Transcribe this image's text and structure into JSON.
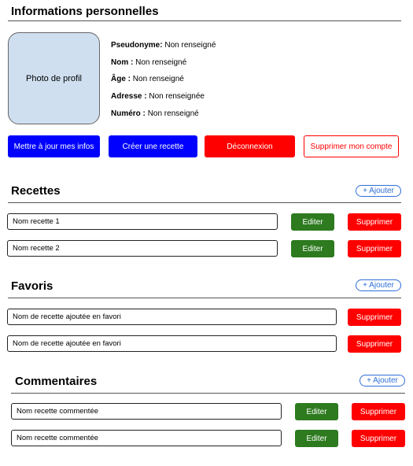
{
  "profile": {
    "title": "Informations personnelles",
    "photo_label": "Photo de profil",
    "fields": [
      {
        "label": "Pseudonyme:",
        "value": "Non renseigné"
      },
      {
        "label": "Nom :",
        "value": "Non renseigné"
      },
      {
        "label": "Âge :",
        "value": "Non renseigné"
      },
      {
        "label": "Adresse :",
        "value": "Non renseignée"
      },
      {
        "label": "Numéro :",
        "value": "Non renseigné"
      }
    ],
    "actions": {
      "update": "Mettre à jour mes infos",
      "create_recipe": "Créer une recette",
      "logout": "Déconnexion",
      "delete_account": "Supprimer mon compte"
    }
  },
  "recipes": {
    "title": "Recettes",
    "add_label": "+ Ajouter",
    "items": [
      "Nom recette 1",
      "Nom recette 2"
    ],
    "edit_label": "Editer",
    "delete_label": "Supprimer"
  },
  "favorites": {
    "title": "Favoris",
    "add_label": "+ Ajouter",
    "items": [
      "Nom de recette ajoutée en favori",
      "Nom de recette ajoutée en favori"
    ],
    "delete_label": "Supprimer"
  },
  "comments": {
    "title": "Commentaires",
    "add_label": "+ Ajouter",
    "items": [
      "Nom recette commentée",
      "Nom recette commentée"
    ],
    "edit_label": "Editer",
    "delete_label": "Supprimer"
  },
  "colors": {
    "primary_blue": "#0000ff",
    "danger_red": "#ff0000",
    "edit_green": "#2d7a1f",
    "add_outline_blue": "#2e6fd8",
    "photo_bg": "#cfdff0"
  }
}
